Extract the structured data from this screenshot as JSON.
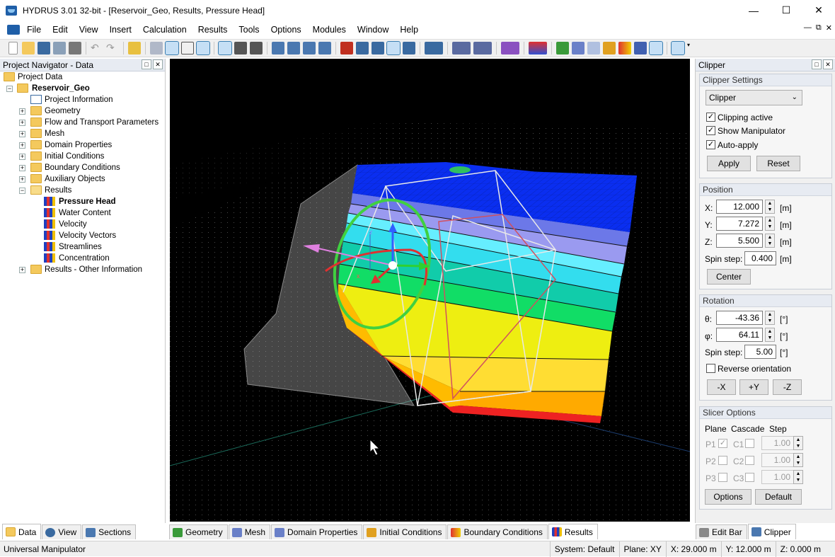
{
  "window": {
    "title": "HYDRUS 3.01 32-bit - [Reservoir_Geo, Results, Pressure Head]"
  },
  "menu": [
    "File",
    "Edit",
    "View",
    "Insert",
    "Calculation",
    "Results",
    "Tools",
    "Options",
    "Modules",
    "Window",
    "Help"
  ],
  "navigator": {
    "title": "Project Navigator - Data",
    "root": "Project Data",
    "project": "Reservoir_Geo",
    "items": [
      {
        "label": "Project Information",
        "type": "info"
      },
      {
        "label": "Geometry",
        "type": "folder"
      },
      {
        "label": "Flow and Transport Parameters",
        "type": "folder"
      },
      {
        "label": "Mesh",
        "type": "folder"
      },
      {
        "label": "Domain Properties",
        "type": "folder"
      },
      {
        "label": "Initial Conditions",
        "type": "folder"
      },
      {
        "label": "Boundary Conditions",
        "type": "folder"
      },
      {
        "label": "Auxiliary Objects",
        "type": "folder"
      },
      {
        "label": "Results",
        "type": "folder-open"
      },
      {
        "label": "Pressure Head",
        "type": "result",
        "bold": true
      },
      {
        "label": "Water Content",
        "type": "result"
      },
      {
        "label": "Velocity",
        "type": "result"
      },
      {
        "label": "Velocity Vectors",
        "type": "result"
      },
      {
        "label": "Streamlines",
        "type": "result"
      },
      {
        "label": "Concentration",
        "type": "result"
      },
      {
        "label": "Results - Other Information",
        "type": "folder"
      }
    ],
    "tabs": [
      "Data",
      "View",
      "Sections"
    ]
  },
  "view_tabs": [
    "Geometry",
    "Mesh",
    "Domain Properties",
    "Initial Conditions",
    "Boundary Conditions",
    "Results"
  ],
  "clipper": {
    "title": "Clipper",
    "settings_title": "Clipper Settings",
    "mode": "Clipper",
    "clipping_active": "Clipping active",
    "show_manipulator": "Show Manipulator",
    "auto_apply": "Auto-apply",
    "apply": "Apply",
    "reset": "Reset",
    "position_title": "Position",
    "x_label": "X:",
    "x": "12.000",
    "y_label": "Y:",
    "y": "7.272",
    "z_label": "Z:",
    "z": "5.500",
    "unit_m": "[m]",
    "spin_label": "Spin step:",
    "spin_pos": "0.400",
    "center": "Center",
    "rotation_title": "Rotation",
    "theta_label": "θ:",
    "theta": "-43.36",
    "phi_label": "φ:",
    "phi": "64.11",
    "unit_deg": "[°]",
    "spin_rot": "5.00",
    "reverse": "Reverse orientation",
    "minus_x": "-X",
    "plus_y": "+Y",
    "minus_z": "-Z",
    "slicer_title": "Slicer Options",
    "col_plane": "Plane",
    "col_cascade": "Cascade",
    "col_step": "Step",
    "planes": [
      {
        "p": "P1",
        "c": "C1",
        "step": "1.00"
      },
      {
        "p": "P2",
        "c": "C2",
        "step": "1.00"
      },
      {
        "p": "P3",
        "c": "C3",
        "step": "1.00"
      }
    ],
    "options": "Options",
    "default": "Default",
    "tabs": [
      "Edit Bar",
      "Clipper"
    ]
  },
  "status": {
    "mode": "Universal Manipulator",
    "system": "System: Default",
    "plane": "Plane: XY",
    "x": "X:  29.000 m",
    "y": "Y:  12.000 m",
    "z": "Z:  0.000 m"
  },
  "colors": {
    "layers": [
      "#0033ee",
      "#8e8ee8",
      "#44eeff",
      "#11d9c8",
      "#11dd88",
      "#11cc11",
      "#eeee11",
      "#ffdd33",
      "#ffaa00",
      "#ee2222"
    ]
  }
}
